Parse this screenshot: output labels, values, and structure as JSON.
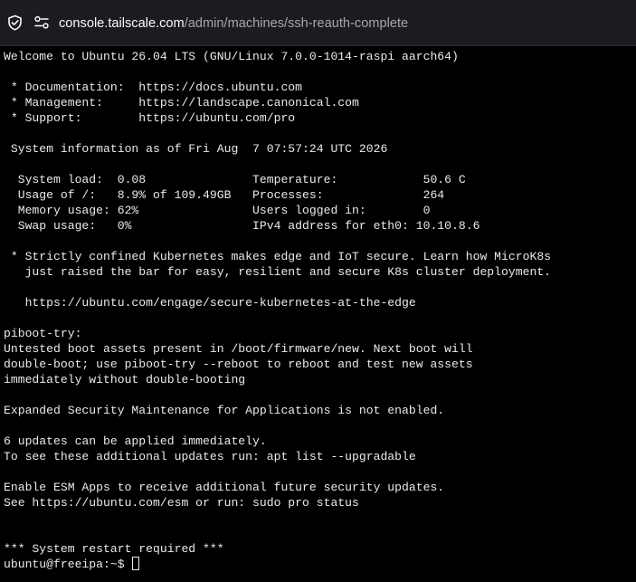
{
  "browser": {
    "url_scheme_host": "console.tailscale.com",
    "url_path": "/admin/machines/ssh-reauth-complete",
    "icons": [
      "shield-icon",
      "permissions-icon"
    ]
  },
  "terminal": {
    "lines": [
      "Welcome to Ubuntu 26.04 LTS (GNU/Linux 7.0.0-1014-raspi aarch64)",
      "",
      " * Documentation:  https://docs.ubuntu.com",
      " * Management:     https://landscape.canonical.com",
      " * Support:        https://ubuntu.com/pro",
      "",
      " System information as of Fri Aug  7 07:57:24 UTC 2026",
      "",
      "  System load:  0.08               Temperature:            50.6 C",
      "  Usage of /:   8.9% of 109.49GB   Processes:              264",
      "  Memory usage: 62%                Users logged in:        0",
      "  Swap usage:   0%                 IPv4 address for eth0: 10.10.8.6",
      "",
      " * Strictly confined Kubernetes makes edge and IoT secure. Learn how MicroK8s",
      "   just raised the bar for easy, resilient and secure K8s cluster deployment.",
      "",
      "   https://ubuntu.com/engage/secure-kubernetes-at-the-edge",
      "",
      "piboot-try:",
      "Untested boot assets present in /boot/firmware/new. Next boot will",
      "double-boot; use piboot-try --reboot to reboot and test new assets",
      "immediately without double-booting",
      "",
      "Expanded Security Maintenance for Applications is not enabled.",
      "",
      "6 updates can be applied immediately.",
      "To see these additional updates run: apt list --upgradable",
      "",
      "Enable ESM Apps to receive additional future security updates.",
      "See https://ubuntu.com/esm or run: sudo pro status",
      "",
      "",
      "*** System restart required ***"
    ],
    "prompt": "ubuntu@freeipa:~$ "
  },
  "colors": {
    "terminal_bg": "#000000",
    "terminal_fg": "#eaeaea",
    "urlbar_bg": "#1c1b22"
  }
}
